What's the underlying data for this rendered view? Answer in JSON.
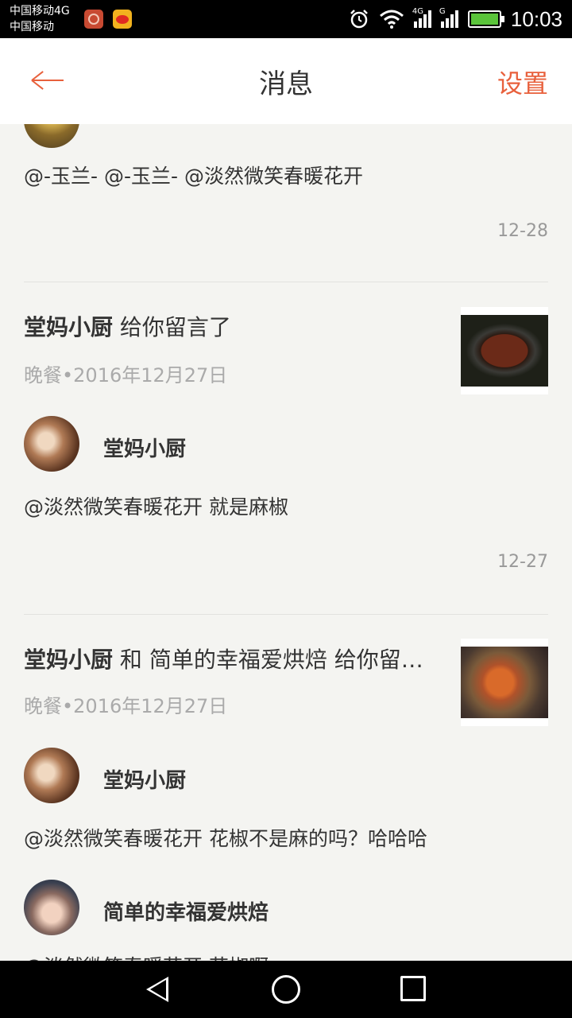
{
  "status_bar": {
    "carrier_line1": "中国移动4G",
    "carrier_line2": "中国移动",
    "network1": "4G",
    "network2": "G",
    "time": "10:03"
  },
  "header": {
    "title": "消息",
    "right_action": "设置"
  },
  "messages": [
    {
      "text": "@-玉兰- @-玉兰- @淡然微笑春暖花开",
      "time": "12-28"
    },
    {
      "author": "堂妈小厨",
      "action": "给你留言了",
      "meta": "晚餐•2016年12月27日",
      "replies": [
        {
          "name": "堂妈小厨",
          "text": "@淡然微笑春暖花开 就是麻椒"
        }
      ],
      "time": "12-27"
    },
    {
      "author": "堂妈小厨",
      "action": "和 简单的幸福爱烘焙 给你留言了",
      "meta": "晚餐•2016年12月27日",
      "replies": [
        {
          "name": "堂妈小厨",
          "text": "@淡然微笑春暖花开 花椒不是麻的吗？哈哈哈"
        },
        {
          "name": "简单的幸福爱烘焙",
          "text": "@淡然微笑春暖花开 花椒啊"
        }
      ]
    }
  ],
  "icons": [
    "back-arrow-icon",
    "alarm-icon",
    "wifi-icon",
    "signal-icon",
    "battery-icon",
    "nav-back-icon",
    "nav-home-icon",
    "nav-recent-icon"
  ]
}
